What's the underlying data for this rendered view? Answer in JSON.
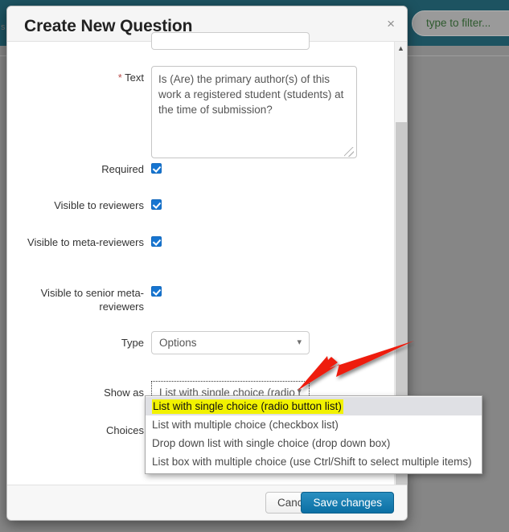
{
  "background": {
    "filter_placeholder": "type to filter...",
    "left_edge_text": "s",
    "topbar_color": "#1d5361"
  },
  "modal": {
    "title": "Create New Question",
    "close_label": "×",
    "fields": {
      "text": {
        "label": "Text",
        "required_marker": "*",
        "value": "Is (Are) the primary author(s) of this work a registered student (students) at the time of submission?"
      },
      "required": {
        "label": "Required",
        "checked": true
      },
      "visible_reviewers": {
        "label": "Visible to reviewers",
        "checked": true
      },
      "visible_meta_reviewers": {
        "label": "Visible to meta-reviewers",
        "checked": true
      },
      "visible_senior_meta_reviewers": {
        "label": "Visible to senior meta-reviewers",
        "checked": true
      },
      "type": {
        "label": "Type",
        "value": "Options"
      },
      "show_as": {
        "label": "Show as",
        "value": "List with single choice (radio l",
        "options": [
          "List with single choice (radio button list)",
          "List with multiple choice (checkbox list)",
          "Drop down list with single choice (drop down box)",
          "List box with multiple choice (use Ctrl/Shift to select multiple items)"
        ],
        "selected_index": 0
      },
      "choices": {
        "label": "Choices"
      }
    },
    "footer": {
      "cancel_label": "Cancel",
      "save_label": "Save changes"
    }
  },
  "annotation": {
    "arrow_color": "#ee1c10"
  },
  "highlight_color": "#f2f200"
}
